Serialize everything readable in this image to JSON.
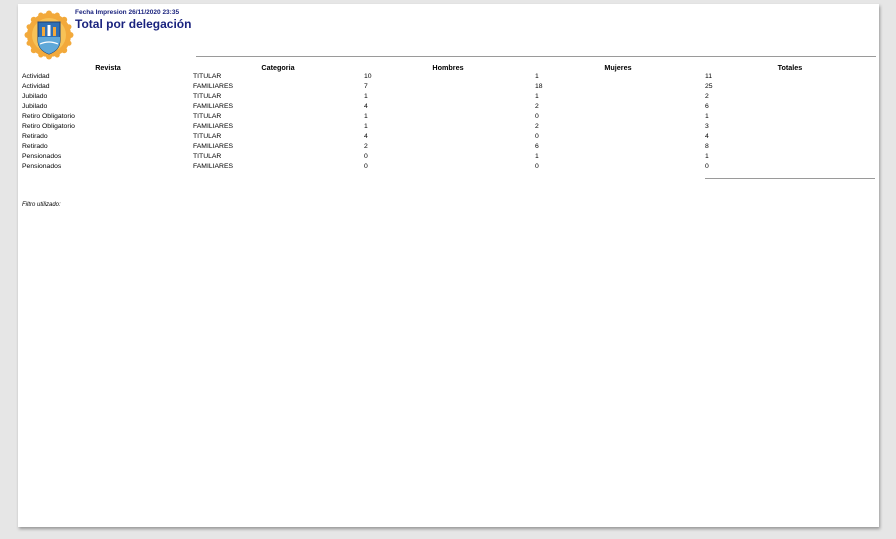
{
  "report": {
    "print_date": "Fecha Impresion 26/11/2020 23:35",
    "title": "Total por delegación",
    "filter_label": "Filtro utilizado:"
  },
  "table": {
    "headers": [
      "Revista",
      "Categoria",
      "Hombres",
      "Mujeres",
      "Totales"
    ],
    "rows": [
      [
        "Actividad",
        "TITULAR",
        "10",
        "1",
        "11"
      ],
      [
        "Actividad",
        "FAMILIARES",
        "7",
        "18",
        "25"
      ],
      [
        "Jubilado",
        "TITULAR",
        "1",
        "1",
        "2"
      ],
      [
        "Jubilado",
        "FAMILIARES",
        "4",
        "2",
        "6"
      ],
      [
        "Retiro Obligatorio",
        "TITULAR",
        "1",
        "0",
        "1"
      ],
      [
        "Retiro Obligatorio",
        "FAMILIARES",
        "1",
        "2",
        "3"
      ],
      [
        "Retirado",
        "TITULAR",
        "4",
        "0",
        "4"
      ],
      [
        "Retirado",
        "FAMILIARES",
        "2",
        "6",
        "8"
      ],
      [
        "Pensionados",
        "TITULAR",
        "0",
        "1",
        "1"
      ],
      [
        "Pensionados",
        "FAMILIARES",
        "0",
        "0",
        "0"
      ]
    ]
  },
  "colors": {
    "title": "#1a237e",
    "seal_outer": "#f2a93b",
    "seal_shield": "#2f6fb3"
  }
}
